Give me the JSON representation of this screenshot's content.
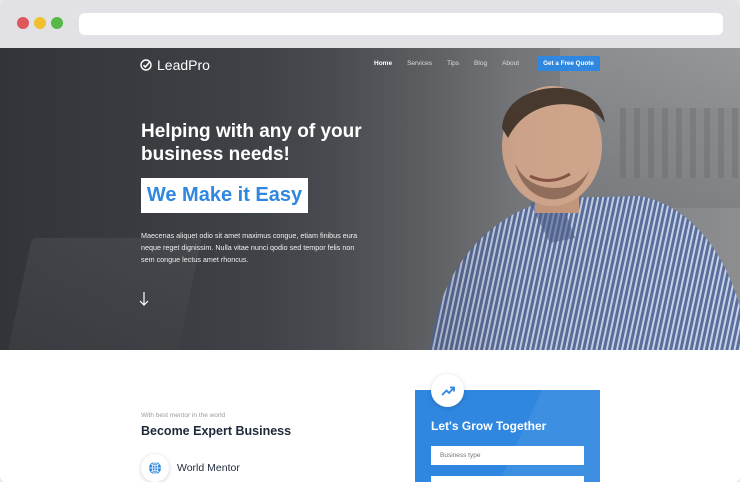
{
  "browser": {
    "buttons": [
      "close",
      "minimize",
      "maximize"
    ]
  },
  "nav": {
    "logo": "LeadPro",
    "logo_icon": "check-circle-icon",
    "items": [
      "Home",
      "Services",
      "Tips",
      "Blog",
      "About"
    ],
    "active_item": "Home",
    "cta": "Get a Free Quote"
  },
  "hero": {
    "headline_line1": "Helping with any of your",
    "headline_line2": "business needs!",
    "highlight": "We Make it Easy",
    "description": "Maecenas aliquet odio sit amet maximus congue, etiam finibus eura neque reget dignissim. Nulla vitae nunci qodio sed tempor felis non sem congue lectus amet rhoncus.",
    "scroll_icon": "arrow-down-icon"
  },
  "section": {
    "kicker": "With best mentor in the world",
    "title": "Become Expert Business",
    "feature": {
      "icon": "globe-icon",
      "label": "World Mentor"
    }
  },
  "form": {
    "icon": "trending-up-icon",
    "title": "Let's Grow Together",
    "business_type_placeholder": "Business type"
  },
  "colors": {
    "accent": "#2f87e0",
    "dark_text": "#1e2a3b",
    "window_red": "#e0575b",
    "window_yellow": "#f2c02f",
    "window_green": "#56b847"
  }
}
